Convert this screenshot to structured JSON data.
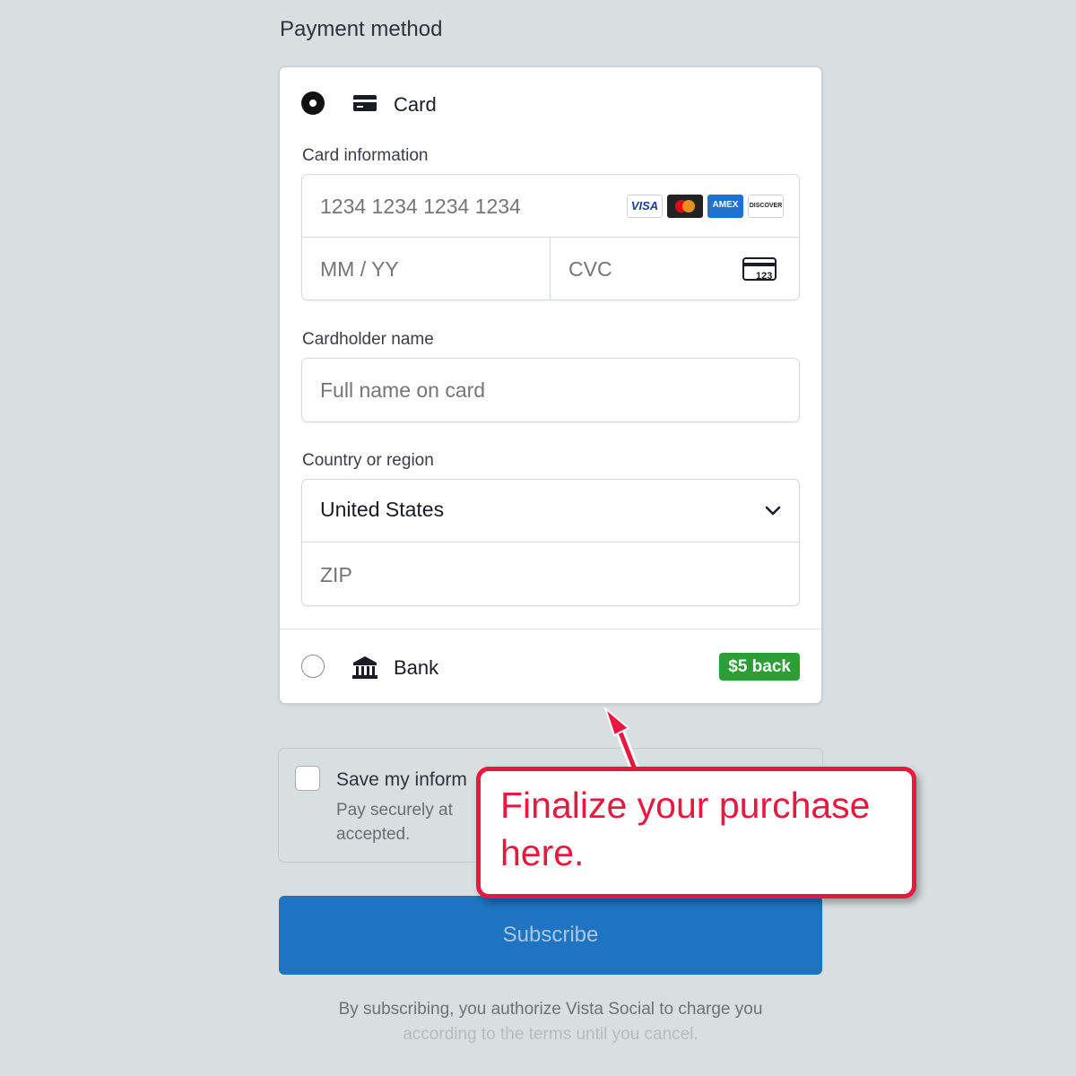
{
  "section_title": "Payment method",
  "card_option": {
    "label": "Card",
    "selected": true,
    "icon": "credit-card-icon"
  },
  "card_info": {
    "label": "Card information",
    "number_placeholder": "1234 1234 1234 1234",
    "expiry_placeholder": "MM / YY",
    "cvc_placeholder": "CVC",
    "cvc_icon_text": "123",
    "brands": [
      "VISA",
      "Mastercard",
      "AMEX",
      "DISCOVER"
    ]
  },
  "cardholder": {
    "label": "Cardholder name",
    "placeholder": "Full name on card"
  },
  "country": {
    "label": "Country or region",
    "value": "United States",
    "zip_placeholder": "ZIP"
  },
  "bank_option": {
    "label": "Bank",
    "selected": false,
    "icon": "bank-icon",
    "badge": "$5 back"
  },
  "save_info": {
    "title": "Save my inform",
    "description_line1": "Pay securely at",
    "description_line2": "accepted."
  },
  "subscribe_label": "Subscribe",
  "legal": {
    "line1": "By subscribing, you authorize Vista Social to charge you",
    "line2": "according to the terms until you cancel."
  },
  "callout": {
    "text": "Finalize your purchase here."
  },
  "colors": {
    "background": "#d9dee0",
    "subscribe": "#1e74c0",
    "badge": "#2b9f36",
    "callout_accent": "#e8183f"
  }
}
